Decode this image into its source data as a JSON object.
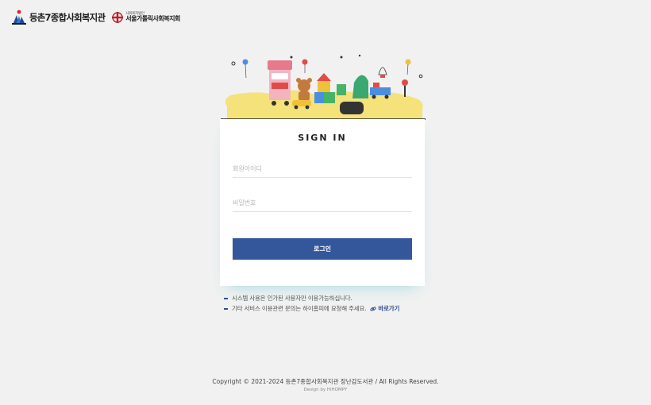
{
  "header": {
    "logo1_text": "등촌7종합사회복지관",
    "logo2_subtext": "사회복지법인",
    "logo2_text": "서울가톨릭사회복지회"
  },
  "login": {
    "title": "SIGN IN",
    "id_placeholder": "회원아이디",
    "pw_placeholder": "비밀번호",
    "button_label": "로그인"
  },
  "notes": {
    "line1": "시스템 사용은 인가된 사용자만 이용가능하십니다.",
    "line2": "기타 서비스 이용관련 문의는 하이홈피에 요청해 주세요.",
    "link_label": "바로가기"
  },
  "footer": {
    "copyright": "Copyright © 2021-2024 등촌7종합사회복지관 장난감도서관 / All Rights Reserved.",
    "design": "Design by HiHOMPY"
  },
  "colors": {
    "background": "#f1f1f1",
    "button": "#34579c",
    "accent": "#2d4f8e",
    "sand": "#f5e27a"
  },
  "icons": {
    "logo1": "community-logo-icon",
    "logo2": "cross-logo-icon",
    "link": "link-icon"
  }
}
